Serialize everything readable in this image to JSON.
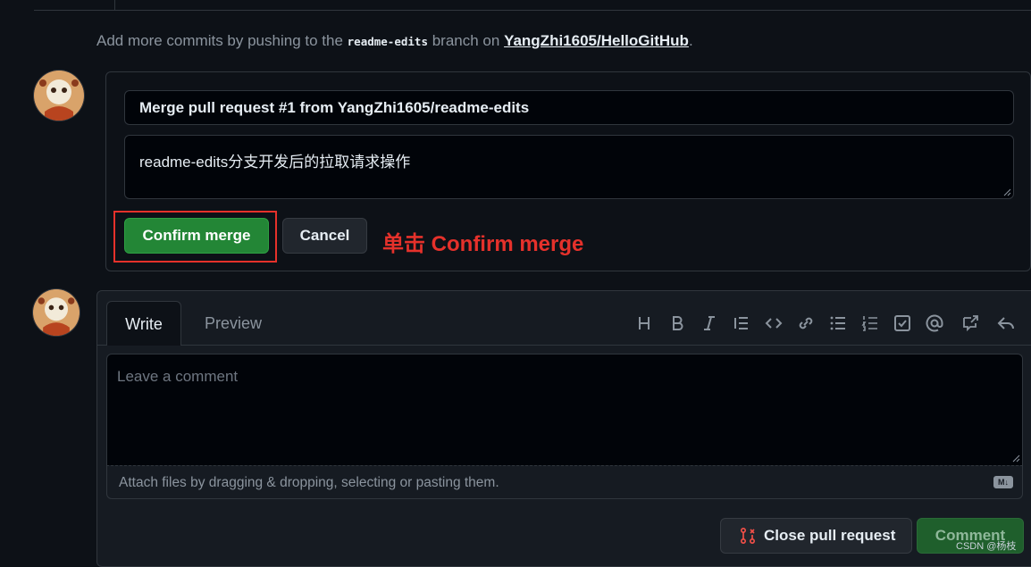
{
  "push_note": {
    "prefix": "Add more commits by pushing to the",
    "branch": "readme-edits",
    "middle": "branch on",
    "repo": "YangZhi1605/HelloGitHub",
    "suffix": "."
  },
  "merge": {
    "title_value": "Merge pull request #1 from YangZhi1605/readme-edits",
    "body_value": "readme-edits分支开发后的拉取请求操作",
    "confirm_label": "Confirm merge",
    "cancel_label": "Cancel"
  },
  "annotation": "单击 Confirm merge",
  "comment": {
    "tabs": [
      "Write",
      "Preview"
    ],
    "toolbar_icons": [
      "heading-icon",
      "bold-icon",
      "italic-icon",
      "quote-icon",
      "code-icon",
      "link-icon",
      "unordered-list-icon",
      "ordered-list-icon",
      "task-list-icon",
      "mention-icon",
      "cross-reference-icon",
      "reply-icon"
    ],
    "placeholder": "Leave a comment",
    "attach_text": "Attach files by dragging & dropping, selecting or pasting them.",
    "markdown_badge": "M↓",
    "close_label": "Close pull request",
    "comment_label": "Comment"
  },
  "watermark": "CSDN @杨枝",
  "colors": {
    "background": "#0d1117",
    "confirm_green": "#238636",
    "annotation_red": "#e5312b"
  }
}
